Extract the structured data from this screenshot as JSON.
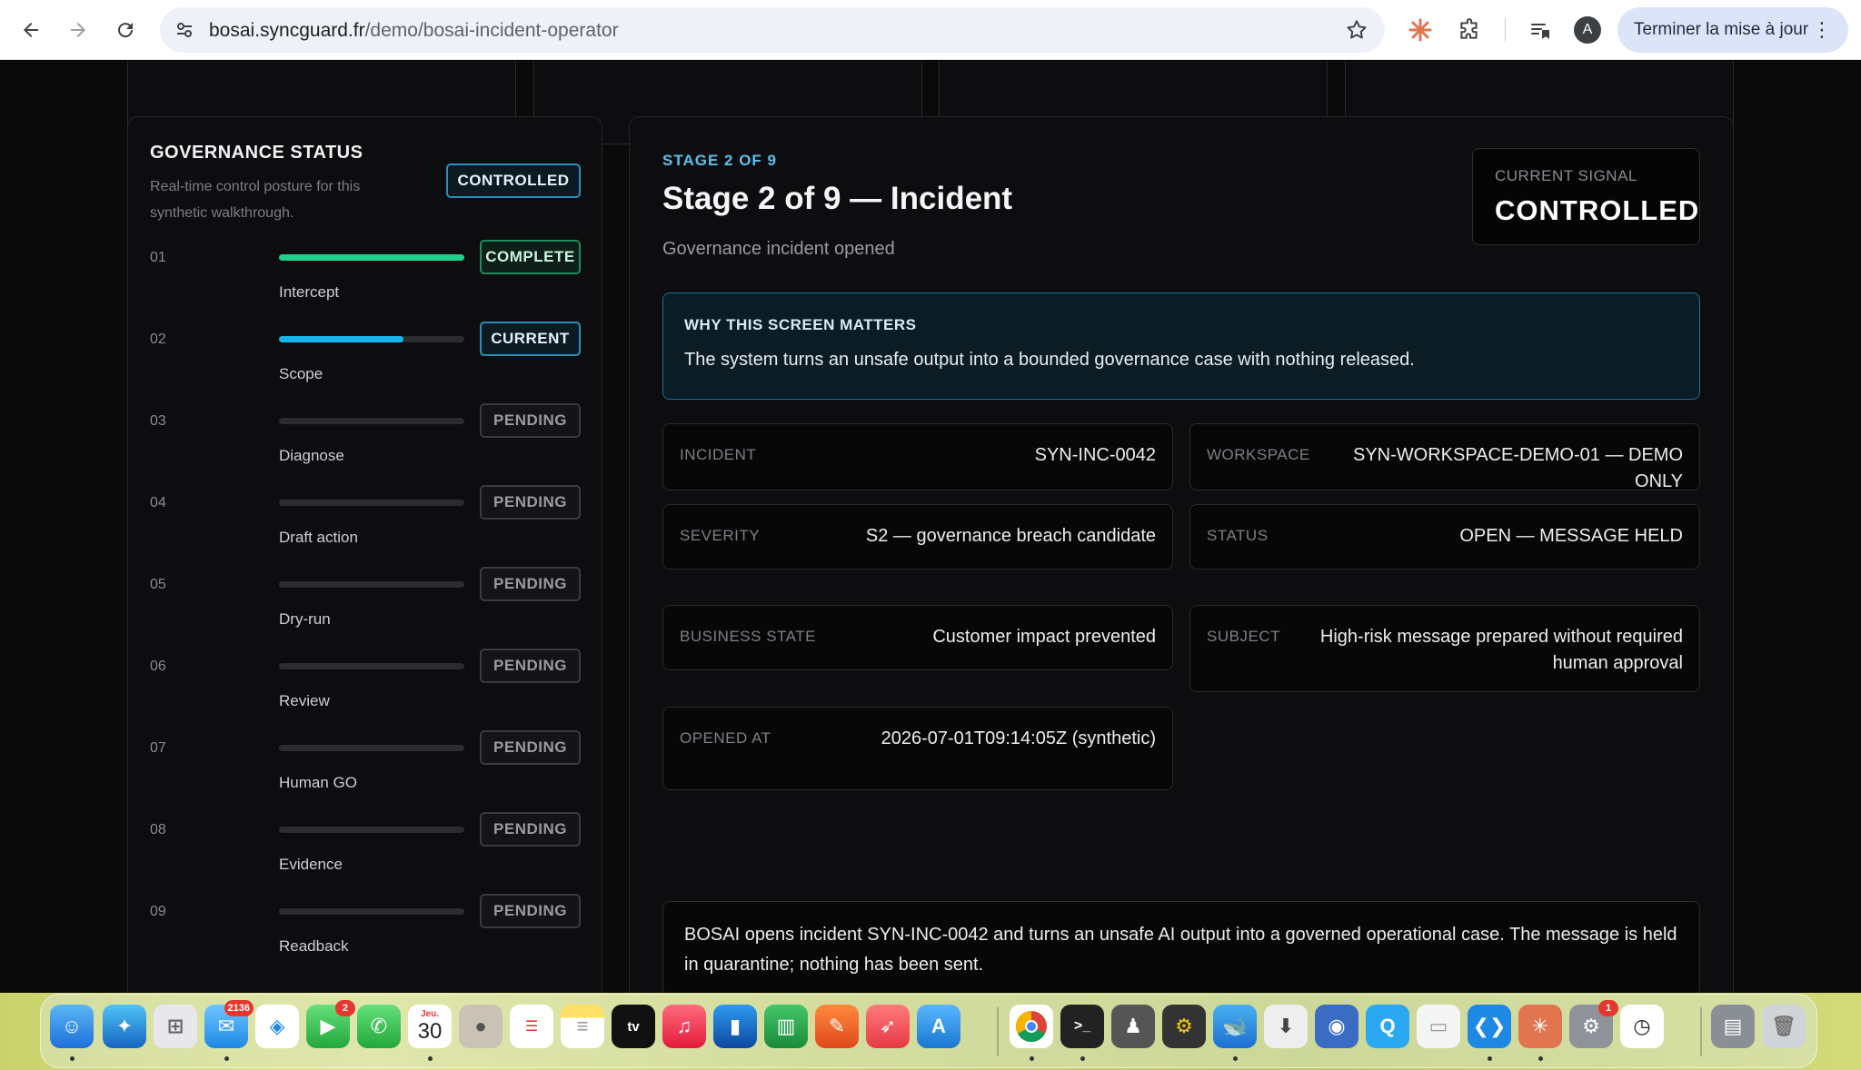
{
  "browser": {
    "url_domain": "bosai.syncguard.fr",
    "url_path": "/demo/bosai-incident-operator",
    "profile_initial": "A",
    "update_label": "Terminer la mise à jour"
  },
  "governance": {
    "title": "GOVERNANCE STATUS",
    "subtitle": "Real-time control posture for this synthetic walkthrough.",
    "badge": "CONTROLLED",
    "steps": [
      {
        "num": "01",
        "label": "Intercept",
        "status": "COMPLETE",
        "progress": 1.0
      },
      {
        "num": "02",
        "label": "Scope",
        "status": "CURRENT",
        "progress": 0.67
      },
      {
        "num": "03",
        "label": "Diagnose",
        "status": "PENDING",
        "progress": 0
      },
      {
        "num": "04",
        "label": "Draft action",
        "status": "PENDING",
        "progress": 0
      },
      {
        "num": "05",
        "label": "Dry-run",
        "status": "PENDING",
        "progress": 0
      },
      {
        "num": "06",
        "label": "Review",
        "status": "PENDING",
        "progress": 0
      },
      {
        "num": "07",
        "label": "Human GO",
        "status": "PENDING",
        "progress": 0
      },
      {
        "num": "08",
        "label": "Evidence",
        "status": "PENDING",
        "progress": 0
      },
      {
        "num": "09",
        "label": "Readback",
        "status": "PENDING",
        "progress": 0
      }
    ],
    "colors": {
      "complete": "#1fd08a",
      "current": "#18b4ec",
      "pending": "#2b2b30"
    }
  },
  "stage": {
    "kicker": "STAGE 2 OF 9",
    "title": "Stage 2 of 9 — Incident",
    "subtitle": "Governance incident opened",
    "signal_label": "CURRENT SIGNAL",
    "signal_value": "CONTROLLED",
    "why_heading": "WHY THIS SCREEN MATTERS",
    "why_body": "The system turns an unsafe output into a bounded governance case with nothing released.",
    "fields": {
      "incident": {
        "key": "INCIDENT",
        "value": "SYN-INC-0042"
      },
      "workspace": {
        "key": "WORKSPACE",
        "value": "SYN-WORKSPACE-DEMO-01 — DEMO ONLY"
      },
      "severity": {
        "key": "SEVERITY",
        "value": "S2 — governance breach candidate"
      },
      "status": {
        "key": "STATUS",
        "value": "OPEN — MESSAGE HELD"
      },
      "business_state": {
        "key": "BUSINESS STATE",
        "value": "Customer impact prevented"
      },
      "subject": {
        "key": "SUBJECT",
        "value": "High-risk message prepared without required human approval"
      },
      "opened_at": {
        "key": "OPENED AT",
        "value": "2026-07-01T09:14:05Z (synthetic)"
      }
    },
    "narrative": "BOSAI opens incident SYN-INC-0042 and turns an unsafe AI output into a governed operational case. The message is held in quarantine; nothing has been sent."
  },
  "dock": {
    "mail_badge": "2136",
    "calendar_month": "Jeu.",
    "calendar_day": "30",
    "facetime_badge": "2",
    "tv_label": "tv",
    "settings_badge": "1"
  }
}
